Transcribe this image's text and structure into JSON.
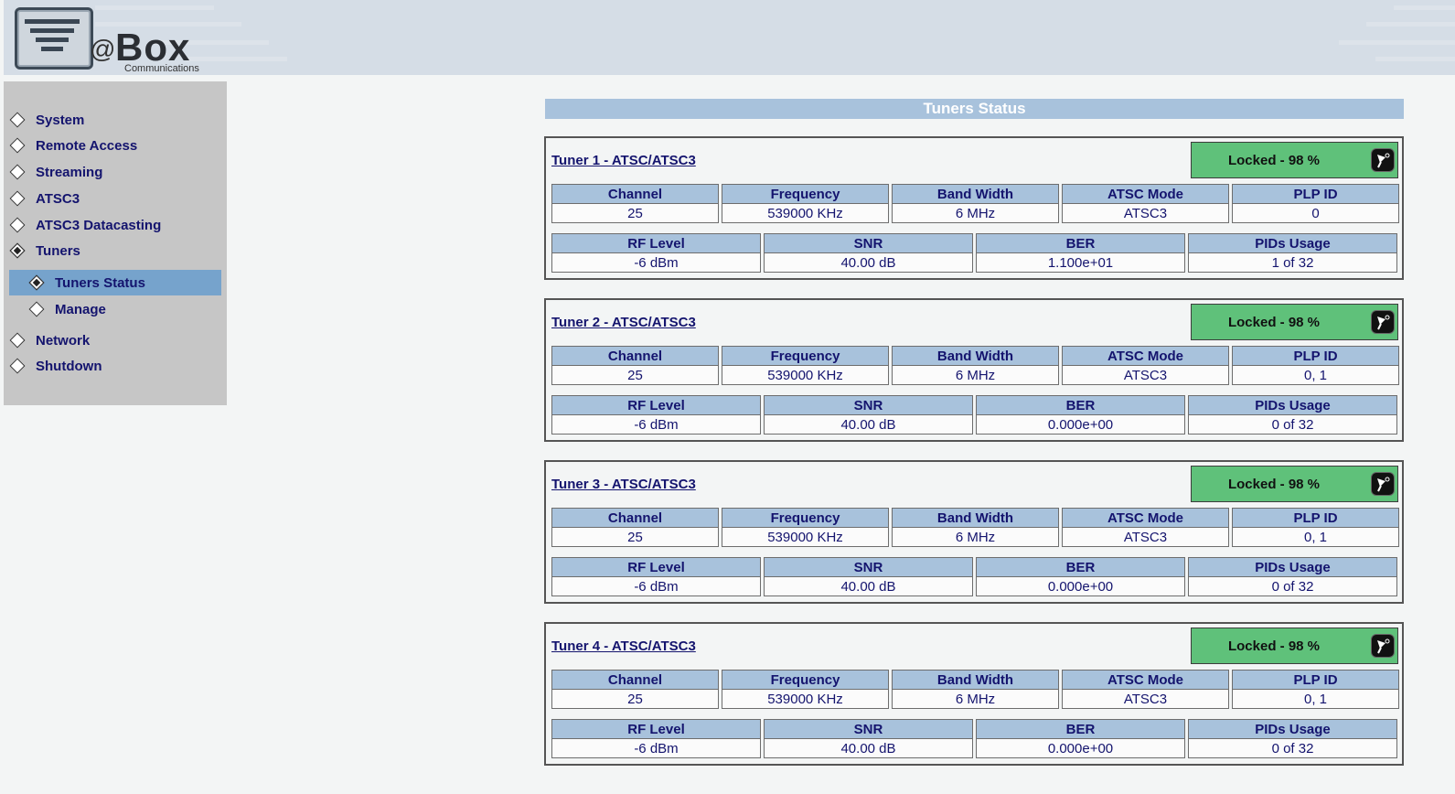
{
  "logo": {
    "at": "@",
    "box": "Box",
    "sub": "Communications"
  },
  "nav": {
    "items": [
      {
        "label": "System"
      },
      {
        "label": "Remote Access"
      },
      {
        "label": "Streaming"
      },
      {
        "label": "ATSC3"
      },
      {
        "label": "ATSC3 Datacasting"
      },
      {
        "label": "Tuners"
      },
      {
        "label": "Tuners Status"
      },
      {
        "label": "Manage"
      },
      {
        "label": "Network"
      },
      {
        "label": "Shutdown"
      }
    ]
  },
  "page": {
    "title": "Tuners Status"
  },
  "columns": {
    "row1": [
      "Channel",
      "Frequency",
      "Band Width",
      "ATSC Mode",
      "PLP ID"
    ],
    "row2": [
      "RF Level",
      "SNR",
      "BER",
      "PIDs Usage"
    ]
  },
  "tuners": [
    {
      "name": "Tuner 1 - ATSC/ATSC3",
      "lock": "Locked -  98 %",
      "channel": "25",
      "frequency": "539000 KHz",
      "bandwidth": "6 MHz",
      "mode": "ATSC3",
      "plp": "0",
      "rf": "-6 dBm",
      "snr": "40.00 dB",
      "ber": "1.100e+01",
      "pids": "1 of 32"
    },
    {
      "name": "Tuner 2 - ATSC/ATSC3",
      "lock": "Locked -  98 %",
      "channel": "25",
      "frequency": "539000 KHz",
      "bandwidth": "6 MHz",
      "mode": "ATSC3",
      "plp": "0, 1",
      "rf": "-6 dBm",
      "snr": "40.00 dB",
      "ber": "0.000e+00",
      "pids": "0 of 32"
    },
    {
      "name": "Tuner 3 - ATSC/ATSC3",
      "lock": "Locked -  98 %",
      "channel": "25",
      "frequency": "539000 KHz",
      "bandwidth": "6 MHz",
      "mode": "ATSC3",
      "plp": "0, 1",
      "rf": "-6 dBm",
      "snr": "40.00 dB",
      "ber": "0.000e+00",
      "pids": "0 of 32"
    },
    {
      "name": "Tuner 4 - ATSC/ATSC3",
      "lock": "Locked -  98 %",
      "channel": "25",
      "frequency": "539000 KHz",
      "bandwidth": "6 MHz",
      "mode": "ATSC3",
      "plp": "0, 1",
      "rf": "-6 dBm",
      "snr": "40.00 dB",
      "ber": "0.000e+00",
      "pids": "0 of 32"
    }
  ],
  "colors": {
    "accent": "#a8c2dc",
    "locked": "#5fc17a",
    "active_nav": "#76a3cc",
    "text": "#14146e"
  }
}
